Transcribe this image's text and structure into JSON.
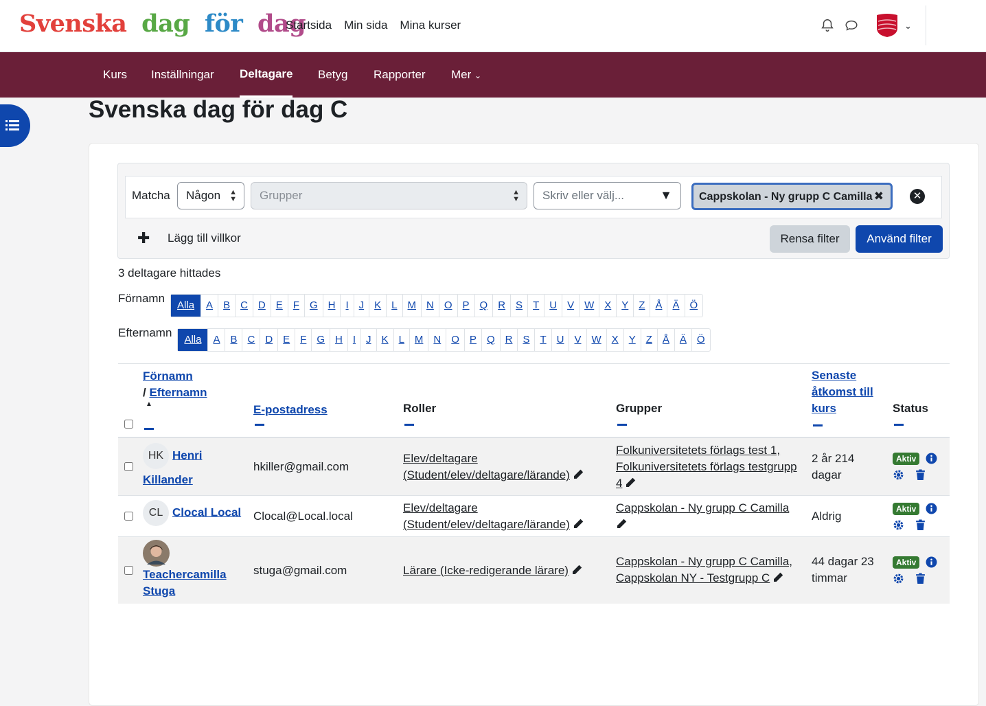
{
  "header": {
    "logo_words": [
      {
        "text": "Svenska",
        "color": "#e2403b"
      },
      {
        "text": "dag",
        "color": "#58a845"
      },
      {
        "text": "för",
        "color": "#2d8ac7"
      },
      {
        "text": "dag",
        "color": "#b14b8a"
      }
    ],
    "nav": [
      "Startsida",
      "Min sida",
      "Mina kurser"
    ]
  },
  "secondary_nav": {
    "items": [
      "Kurs",
      "Inställningar",
      "Deltagare",
      "Betyg",
      "Rapporter",
      "Mer"
    ],
    "active": "Deltagare"
  },
  "page_title": "Svenska dag för dag C",
  "filter": {
    "match_label": "Matcha",
    "match_value": "Någon",
    "type_placeholder": "Grupper",
    "value_placeholder": "Skriv eller välj...",
    "selected_chip": "Cappskolan - Ny grupp C Camilla",
    "add_condition": "Lägg till villkor",
    "clear_button": "Rensa filter",
    "apply_button": "Använd filter"
  },
  "count_text": "3 deltagare hittades",
  "initials": {
    "firstname_label": "Förnamn",
    "lastname_label": "Efternamn",
    "letters": [
      "Alla",
      "A",
      "B",
      "C",
      "D",
      "E",
      "F",
      "G",
      "H",
      "I",
      "J",
      "K",
      "L",
      "M",
      "N",
      "O",
      "P",
      "Q",
      "R",
      "S",
      "T",
      "U",
      "V",
      "W",
      "X",
      "Y",
      "Z",
      "Å",
      "Ä",
      "Ö"
    ]
  },
  "table": {
    "headers": {
      "firstname": "Förnamn",
      "separator": "/",
      "lastname": "Efternamn",
      "email": "E-postadress",
      "roles": "Roller",
      "groups": "Grupper",
      "lastaccess_1": "Senaste",
      "lastaccess_2": "åtkomst till",
      "lastaccess_3": "kurs",
      "status": "Status"
    },
    "rows": [
      {
        "initials": "HK",
        "name_1": "Henri",
        "name_2": "Killander",
        "email": "hkiller@gmail.com",
        "role_1": "Elev/deltagare",
        "role_2": "(Student/elev/deltagare/lärande)",
        "groups_1": "Folkuniversitetets förlags test 1,",
        "groups_2": "Folkuniversitetets förlags testgrupp",
        "groups_3": "4",
        "access_1": "2 år 214",
        "access_2": "dagar",
        "status": "Aktiv"
      },
      {
        "initials": "CL",
        "name_1": "Clocal Local",
        "email": "Clocal@Local.local",
        "role_1": "Elev/deltagare",
        "role_2": "(Student/elev/deltagare/lärande)",
        "groups_1": "Cappskolan - Ny grupp C Camilla",
        "access_1": "Aldrig",
        "status": "Aktiv"
      },
      {
        "name_1": "Teachercamilla",
        "name_2": "Stuga",
        "email": "stuga@gmail.com",
        "role_1": "Lärare (Icke-redigerande lärare)",
        "groups_1": "Cappskolan - Ny grupp C Camilla,",
        "groups_2": "Cappskolan NY - Testgrupp C",
        "access_1": "44 dagar 23",
        "access_2": "timmar",
        "status": "Aktiv"
      }
    ]
  },
  "icons": [
    "bell-icon",
    "chat-icon",
    "user-menu-chevron-icon",
    "drawer-list-icon",
    "info-icon",
    "gear-icon",
    "trash-icon",
    "pencil-icon",
    "remove-circle-icon",
    "plus-icon"
  ],
  "colors": {
    "brand_nav": "#6a1f38",
    "primary": "#0f47ad",
    "active_badge": "#357a32"
  }
}
